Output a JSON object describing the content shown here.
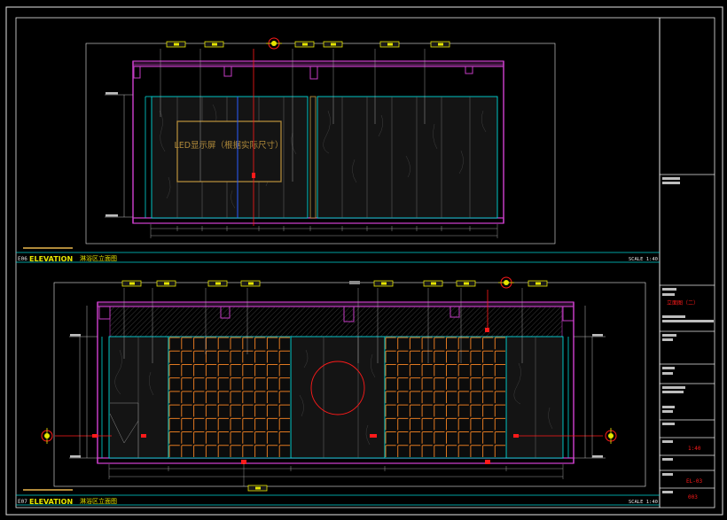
{
  "drawing": {
    "led_label": "LED显示屏（根据实际尺寸）",
    "elevations": [
      {
        "code": "E06",
        "word": "ELEVATION",
        "name": "淋浴区立面图",
        "scale": "SCALE 1:40"
      },
      {
        "code": "E07",
        "word": "ELEVATION",
        "name": "淋浴区立面图",
        "scale": "SCALE 1:40"
      }
    ]
  },
  "title_block": {
    "red_label": "立面图（二）",
    "scale_value": "1:40",
    "sheet_number": "EL-03",
    "page_number": "003"
  },
  "colors": {
    "frame": "#e6e6e6",
    "purple": "#c43cc4",
    "cyan": "#00d7d7",
    "yellow": "#e6e600",
    "red": "#ff1a1a",
    "orange": "#e07820",
    "gold": "#b08a3a"
  }
}
